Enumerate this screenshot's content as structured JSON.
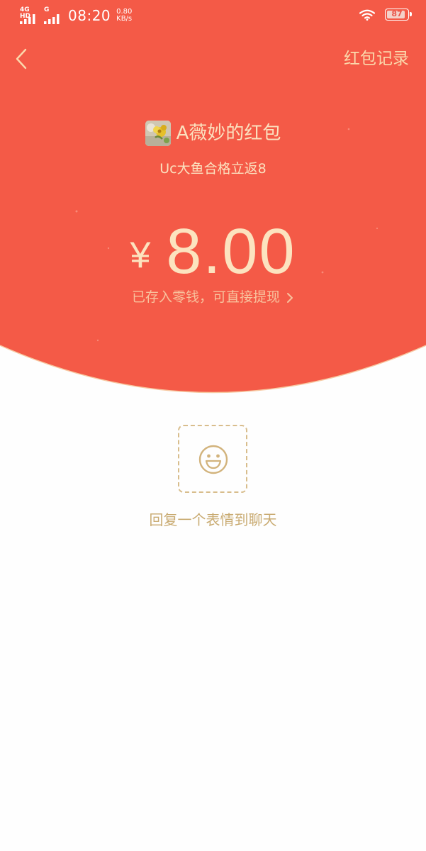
{
  "status_bar": {
    "network_tag_1": "4G HD",
    "network_tag_2": "G",
    "time": "08:20",
    "speed_value": "0.80",
    "speed_unit": "KB/s",
    "battery": "87"
  },
  "header": {
    "records_label": "红包记录"
  },
  "packet": {
    "sender_name": "A薇妙的红包",
    "greeting": "Uc大鱼合格立返8",
    "currency_symbol": "¥",
    "amount": "8.00",
    "stored_text": "已存入零钱，可直接提现"
  },
  "reply": {
    "label": "回复一个表情到聊天"
  },
  "colors": {
    "red_background": "#f45a47",
    "gold_text": "#fbe1bf",
    "reply_gold": "#c9ab72",
    "page_background": "#fefefe"
  },
  "icons": {
    "back": "chevron-left-icon",
    "emoji": "smiley-face-icon",
    "stored_arrow": "chevron-right-icon"
  }
}
